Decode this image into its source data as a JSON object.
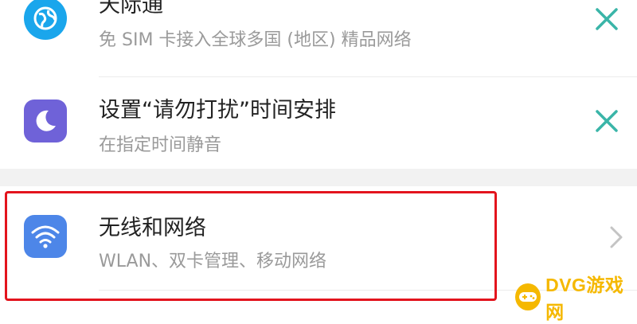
{
  "settings_list": {
    "items": [
      {
        "title": "天际通",
        "subtitle": "免 SIM 卡接入全球多国 (地区) 精品网络",
        "icon": "globe-icon",
        "icon_color": "#1aa6ec",
        "action": "close-icon"
      },
      {
        "title": "设置“请勿打扰”时间安排",
        "subtitle": "在指定时间静音",
        "icon": "moon-icon",
        "icon_color": "#6f62d8",
        "action": "close-icon"
      },
      {
        "title": "无线和网络",
        "subtitle": "WLAN、双卡管理、移动网络",
        "icon": "wifi-icon",
        "icon_color": "#4d86e8",
        "action": "chevron-right-icon"
      }
    ]
  },
  "colors": {
    "close_accent": "#3ab5a8",
    "highlight_border": "#e3141d",
    "section_gap": "#f2f2f2",
    "watermark": "#f5b800"
  },
  "watermark": {
    "text": "DVG游戏网"
  }
}
